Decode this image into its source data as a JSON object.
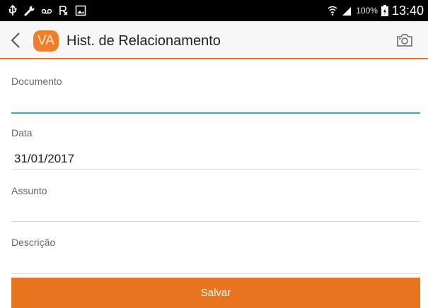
{
  "status_bar": {
    "icons": [
      "usb-icon",
      "wrench-icon",
      "voicemail-icon",
      "rx-icon",
      "image-icon"
    ],
    "right_icons": [
      "wifi-icon",
      "signal-icon",
      "battery-icon"
    ],
    "battery_percent": "100%",
    "time": "13:40"
  },
  "app_bar": {
    "avatar_text": "VA",
    "title": "Hist. de Relacionamento",
    "avatar_color": "#f07e26",
    "accent_color": "#e8741f"
  },
  "form": {
    "documento": {
      "label": "Documento",
      "value": ""
    },
    "data": {
      "label": "Data",
      "value": "31/01/2017"
    },
    "assunto": {
      "label": "Assunto",
      "value": ""
    },
    "descricao": {
      "label": "Descrição",
      "value": ""
    }
  },
  "actions": {
    "save_label": "Salvar"
  }
}
